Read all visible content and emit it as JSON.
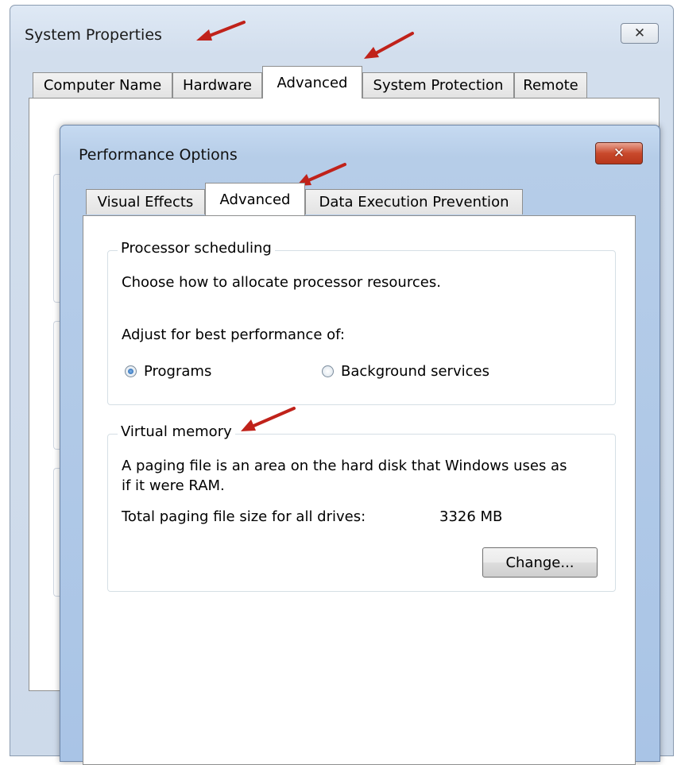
{
  "system_properties": {
    "title": "System Properties",
    "close_label": "✕",
    "tabs": [
      {
        "label": "Computer Name",
        "selected": false
      },
      {
        "label": "Hardware",
        "selected": false
      },
      {
        "label": "Advanced",
        "selected": true
      },
      {
        "label": "System Protection",
        "selected": false
      },
      {
        "label": "Remote",
        "selected": false
      }
    ]
  },
  "performance_options": {
    "title": "Performance Options",
    "close_label": "✕",
    "tabs": [
      {
        "label": "Visual Effects",
        "selected": false
      },
      {
        "label": "Advanced",
        "selected": true
      },
      {
        "label": "Data Execution Prevention",
        "selected": false
      }
    ],
    "processor_scheduling": {
      "legend": "Processor scheduling",
      "description": "Choose how to allocate processor resources.",
      "adjust_label": "Adjust for best performance of:",
      "options": [
        {
          "label": "Programs",
          "checked": true
        },
        {
          "label": "Background services",
          "checked": false
        }
      ]
    },
    "virtual_memory": {
      "legend": "Virtual memory",
      "description_line1": "A paging file is an area on the hard disk that Windows uses as",
      "description_line2": "if it were RAM.",
      "total_label": "Total paging file size for all drives:",
      "total_value": "3326 MB",
      "change_button": "Change..."
    }
  },
  "colors": {
    "annotation_arrow": "#c0221a",
    "radio_selected": "#1b5ea8",
    "close_button_red": "#c9492c"
  }
}
